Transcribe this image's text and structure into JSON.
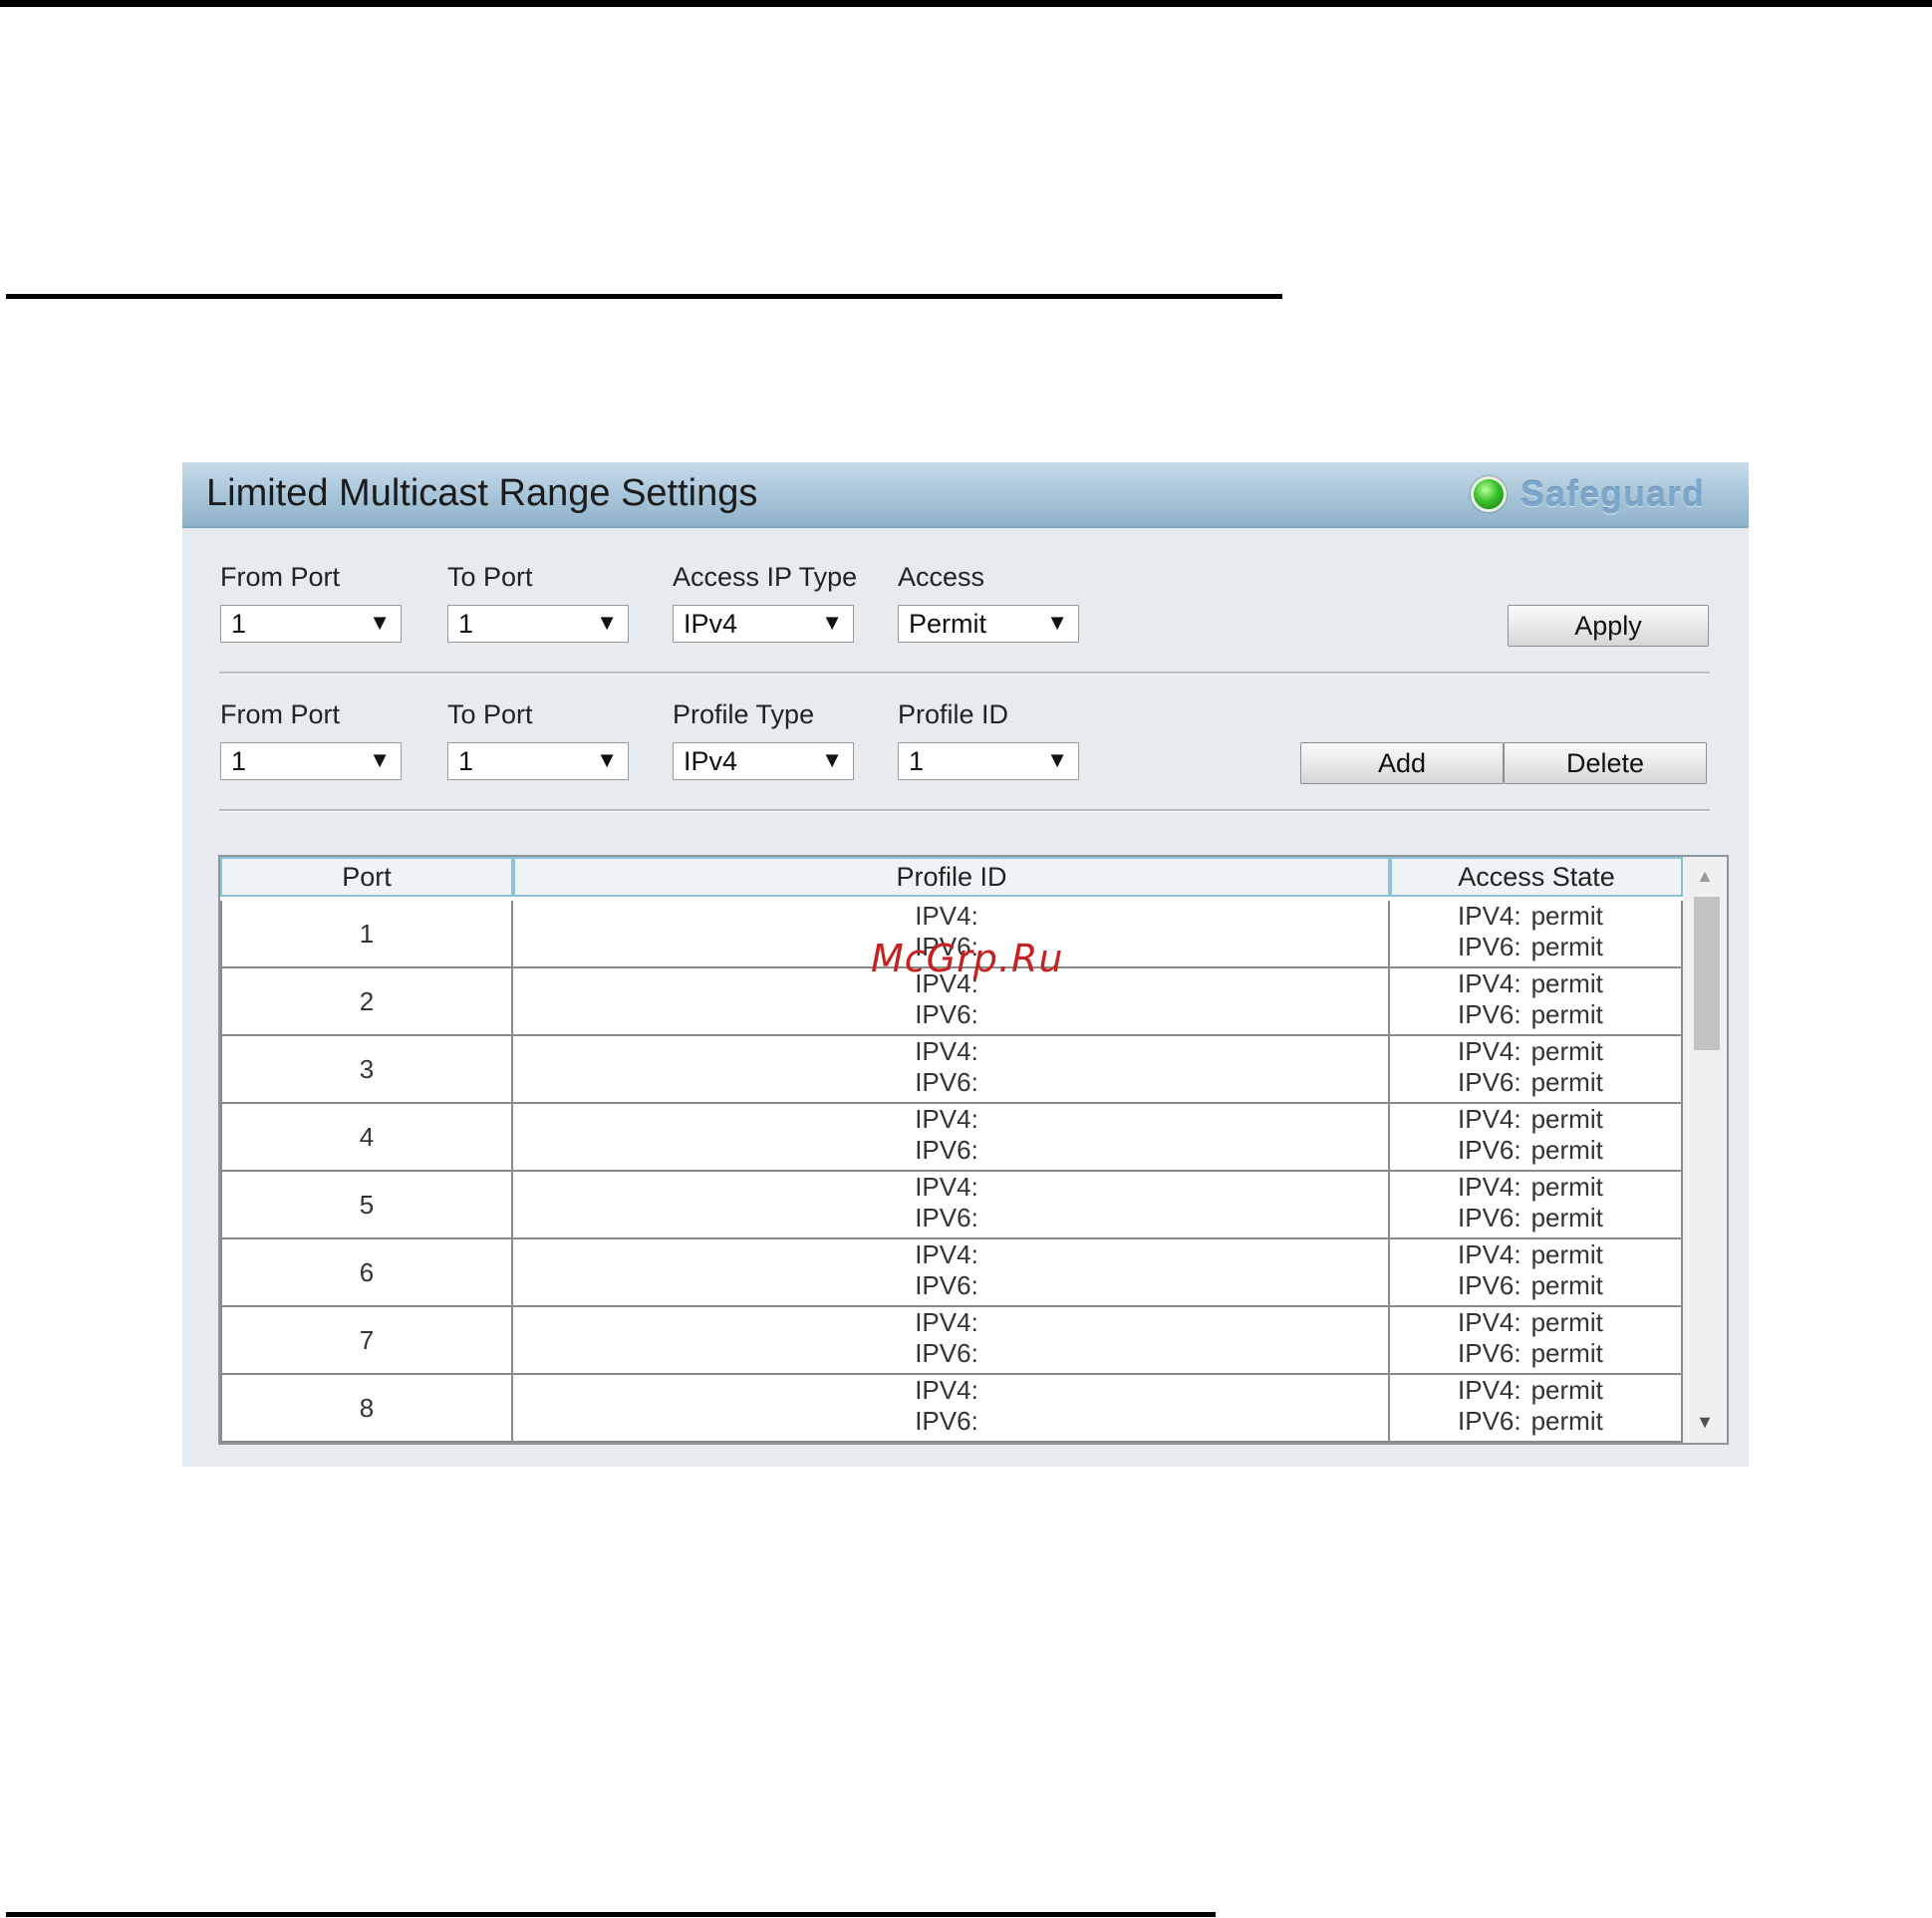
{
  "panel": {
    "title": "Limited Multicast Range Settings",
    "safeguard_label": "Safeguard"
  },
  "access_form": {
    "from_port": {
      "label": "From Port",
      "value": "1"
    },
    "to_port": {
      "label": "To Port",
      "value": "1"
    },
    "access_ip_type": {
      "label": "Access IP Type",
      "value": "IPv4"
    },
    "access": {
      "label": "Access",
      "value": "Permit"
    },
    "apply_label": "Apply"
  },
  "profile_form": {
    "from_port": {
      "label": "From Port",
      "value": "1"
    },
    "to_port": {
      "label": "To Port",
      "value": "1"
    },
    "profile_type": {
      "label": "Profile Type",
      "value": "IPv4"
    },
    "profile_id": {
      "label": "Profile ID",
      "value": "1"
    },
    "add_label": "Add",
    "delete_label": "Delete"
  },
  "table": {
    "headers": [
      "Port",
      "Profile ID",
      "Access State"
    ],
    "ipv4_label": "IPV4:",
    "ipv6_label": "IPV6:",
    "rows": [
      {
        "port": "1",
        "ipv4_state": "permit",
        "ipv6_state": "permit"
      },
      {
        "port": "2",
        "ipv4_state": "permit",
        "ipv6_state": "permit"
      },
      {
        "port": "3",
        "ipv4_state": "permit",
        "ipv6_state": "permit"
      },
      {
        "port": "4",
        "ipv4_state": "permit",
        "ipv6_state": "permit"
      },
      {
        "port": "5",
        "ipv4_state": "permit",
        "ipv6_state": "permit"
      },
      {
        "port": "6",
        "ipv4_state": "permit",
        "ipv6_state": "permit"
      },
      {
        "port": "7",
        "ipv4_state": "permit",
        "ipv6_state": "permit"
      },
      {
        "port": "8",
        "ipv4_state": "permit",
        "ipv6_state": "permit"
      }
    ]
  },
  "icons": {
    "dropdown": "▼",
    "scroll_up": "▲",
    "scroll_down": "▼"
  },
  "watermark": "McGrp.Ru",
  "colors": {
    "header_gradient_mid": "#a9c6da",
    "panel_bg": "#e6ebef",
    "led_green": "#39c22a",
    "safeguard_text": "#7da6cb",
    "watermark_red": "#c62121"
  }
}
